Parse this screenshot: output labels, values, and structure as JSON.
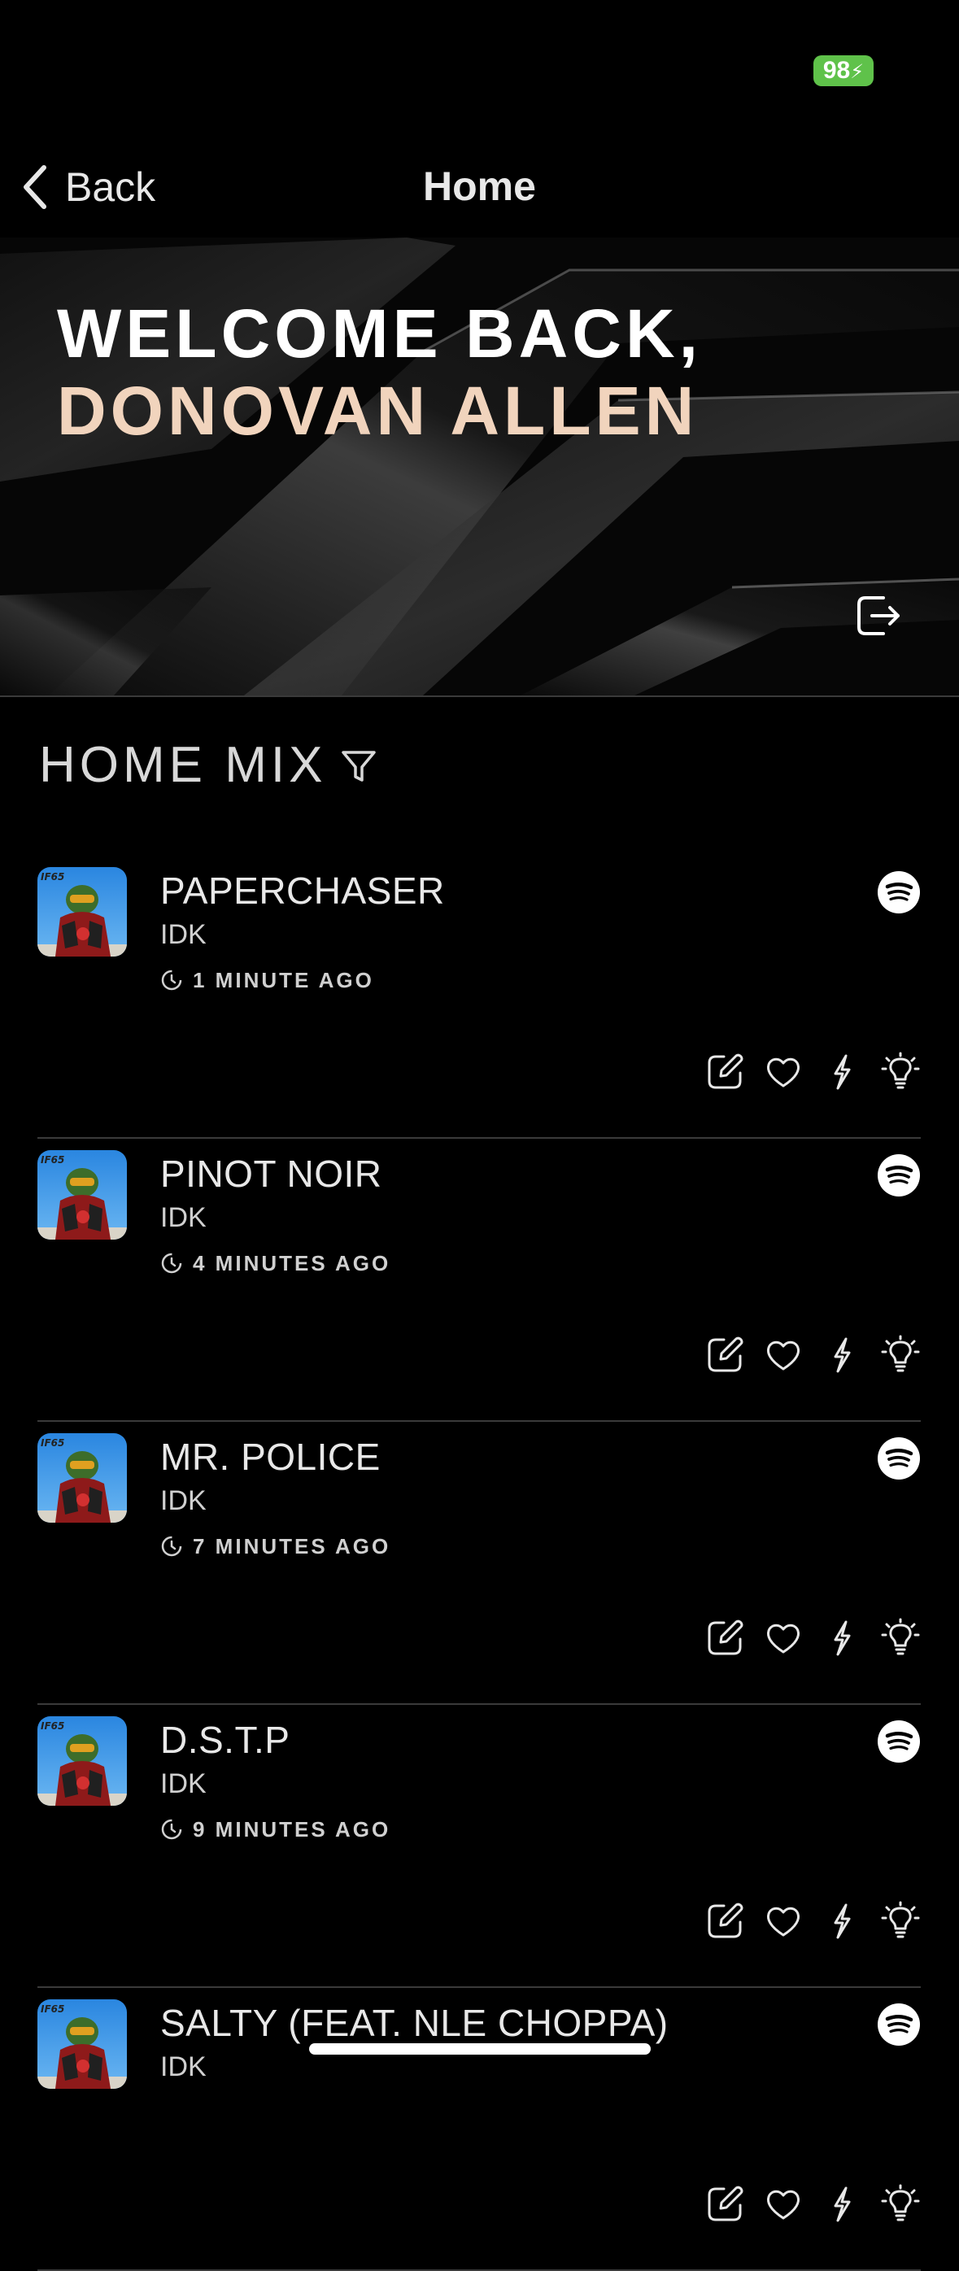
{
  "status_bar": {
    "battery": "98"
  },
  "nav": {
    "back_label": "Back",
    "title": "Home"
  },
  "hero": {
    "greeting": "WELCOME BACK,",
    "user_name": "DONOVAN ALLEN"
  },
  "section": {
    "title": "HOME MIX"
  },
  "tracks": [
    {
      "title": "PAPERCHASER",
      "artist": "IDK",
      "time": "1 MINUTE AGO"
    },
    {
      "title": "PINOT NOIR",
      "artist": "IDK",
      "time": "4 MINUTES AGO"
    },
    {
      "title": "MR. POLICE",
      "artist": "IDK",
      "time": "7 MINUTES AGO"
    },
    {
      "title": "D.S.T.P",
      "artist": "IDK",
      "time": "9 MINUTES AGO"
    },
    {
      "title": "SALTY (FEAT. NLE CHOPPA)",
      "artist": "IDK",
      "time": ""
    }
  ],
  "colors": {
    "background": "#000000",
    "accent_name": "#f1d4bd",
    "battery": "#5fc24a"
  },
  "icons": {
    "back": "chevron-left-icon",
    "logout": "logout-icon",
    "filter": "filter-icon",
    "time": "clock-icon",
    "source": "spotify-icon",
    "actions": [
      "edit-icon",
      "heart-icon",
      "bolt-icon",
      "lightbulb-icon"
    ]
  }
}
